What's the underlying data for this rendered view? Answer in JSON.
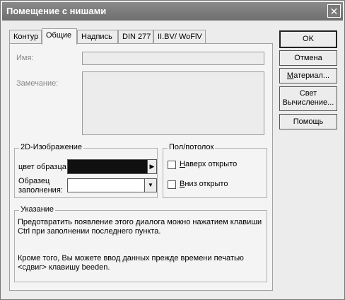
{
  "window": {
    "title": "Помещение с нишами",
    "close_glyph": "✕"
  },
  "tabs": [
    {
      "label": "Контур",
      "active": false
    },
    {
      "label": "Общие",
      "active": true
    },
    {
      "label": "Надпись",
      "active": false
    },
    {
      "label": "DIN 277",
      "active": false
    },
    {
      "label": "II.BV/ WoFlV",
      "active": false
    }
  ],
  "form": {
    "name_label": "Имя:",
    "name_value": "",
    "remark_label": "Замечание:",
    "remark_value": ""
  },
  "image2d": {
    "group_label": "2D-Изображение",
    "color_label": "цвет образца:",
    "color_value": "#101010",
    "arrow_glyph": "▶",
    "fill_label_line1": "Образец",
    "fill_label_line2": "заполнения:",
    "fill_value": "",
    "dropdown_glyph": "▼"
  },
  "floor": {
    "group_label": "Пол/потолок",
    "top_label_first": "Н",
    "top_label_rest": "аверх открыто",
    "bottom_label_first": "В",
    "bottom_label_rest": "низ открыто",
    "top_checked": false,
    "bottom_checked": false
  },
  "hint": {
    "group_label": "Указание",
    "line1": "Предотвратить появление этого диалога можно нажатием клавиши",
    "line2": "Ctrl при заполнении последнего пункта.",
    "line3": "Кроме того, Вы можете ввод данных прежде времени печатью",
    "line4": "<сдвиг> клавишу beeden."
  },
  "buttons": {
    "ok": "OK",
    "cancel": "Отмена",
    "material_first": "М",
    "material_rest": "атериал...",
    "light_line1": "Свет",
    "light_line2": "Вычисление...",
    "help": "Помощь"
  }
}
